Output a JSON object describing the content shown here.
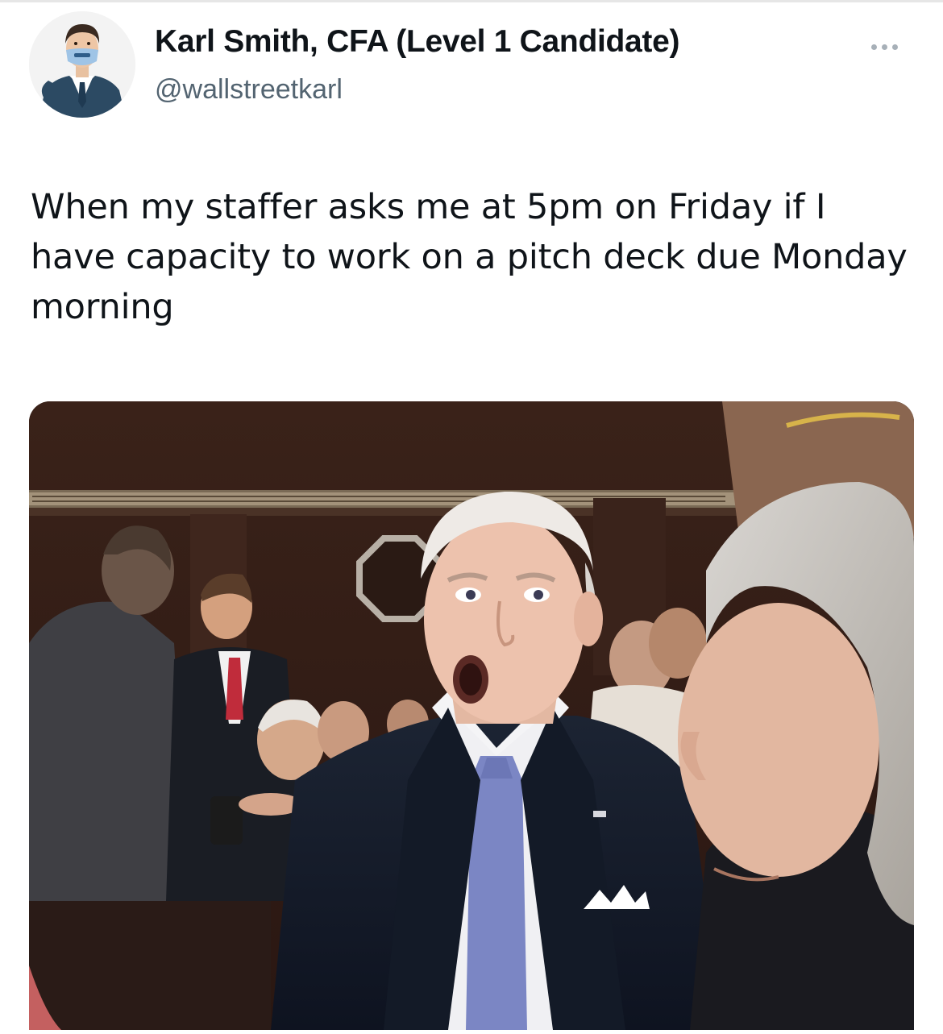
{
  "tweet": {
    "author_name": "Karl Smith, CFA (Level 1 Candidate)",
    "handle": "@wallstreetkarl",
    "text": "When my staffer asks me at 5pm on Friday if I have capacity to work on a pitch deck due Monday morning",
    "more_icon": "more-dots-icon"
  },
  "media": {
    "kind": "photo"
  },
  "colors": {
    "text_primary": "#0f1419",
    "text_secondary": "#536471",
    "background": "#ffffff"
  }
}
